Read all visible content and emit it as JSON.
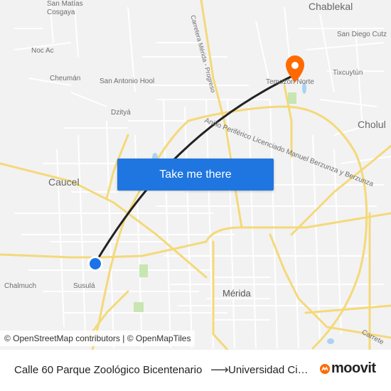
{
  "map": {
    "labels": {
      "san_matias": "San Matías\nCosgaya",
      "chablekal": "Chablekal",
      "san_diego": "San Diego Cutz",
      "noc_ac": "Noc Ac",
      "cheuman": "Cheumán",
      "san_antonio": "San Antonio Hool",
      "temozon": "Temozón Norte",
      "tixcuytun": "Tixcuytún",
      "dzitya": "Dzityá",
      "cholul": "Cholul",
      "caucel": "Caucel",
      "chalmuch": "Chalmuch",
      "susula": "Susulá",
      "merida": "Mérida",
      "carretera": "Carretera Mérida - Progreso",
      "anillo": "Anillo Periférico Licenciado Manuel Berzunza y Berzunza",
      "carrete_se": "Carrete"
    },
    "cta_label": "Take me there",
    "attribution": "© OpenStreetMap contributors | © OpenMapTiles",
    "colors": {
      "road_major": "#f7e08a",
      "road_minor": "#ffffff",
      "route": "#222222",
      "origin": "#1a73e8",
      "destination": "#ff6a00"
    }
  },
  "footer": {
    "from": "Calle 60 Parque Zoológico Bicentenario",
    "arrow": "⟶",
    "to": "Universidad Científica del Sur",
    "brand": "moovit"
  }
}
